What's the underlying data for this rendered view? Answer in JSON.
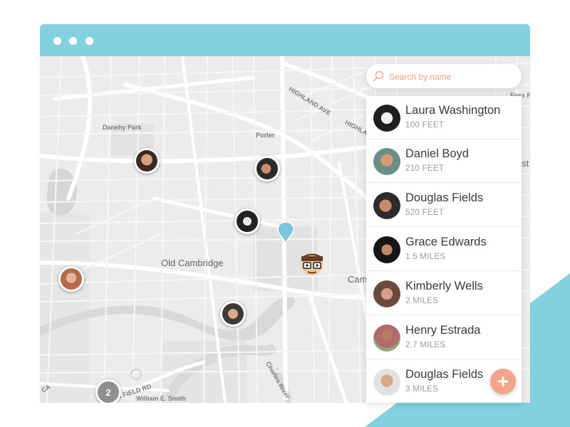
{
  "window": {
    "titlebar_color": "#84cfe0",
    "controls": [
      "dot",
      "dot",
      "dot"
    ]
  },
  "map": {
    "labels": {
      "highland_ave": "HIGHLAND AVE",
      "highland_ave_2": "HIGHLAND AVE",
      "danehy_park": "Danehy Park",
      "porter": "Porter",
      "old_cambridge": "Old Cambridge",
      "cam": "Cam",
      "st": "st",
      "foss_p": "Foss P",
      "charles_river": "Charles River",
      "field_rd": "ERS FIELD RD",
      "william_smith": "William E. Smith",
      "ca": "CA"
    },
    "cluster_count": "2",
    "pin_color": "#78c7dc"
  },
  "search": {
    "placeholder": "Search by name",
    "icon": "search-icon",
    "accent": "#f2a07e"
  },
  "people": [
    {
      "name": "Laura Washington",
      "distance": "100 FEET"
    },
    {
      "name": "Daniel Boyd",
      "distance": "210 FEET"
    },
    {
      "name": "Douglas Fields",
      "distance": "520 FEET"
    },
    {
      "name": "Grace Edwards",
      "distance": "1.5 MILES"
    },
    {
      "name": "Kimberly Wells",
      "distance": "2 MILES"
    },
    {
      "name": "Henry Estrada",
      "distance": "2.7 MILES"
    },
    {
      "name": "Douglas Fields",
      "distance": "3 MILES"
    }
  ],
  "fab": {
    "icon": "plus-icon",
    "color": "#f4a48a"
  },
  "decor": {
    "triangle_color": "#84cfe0"
  }
}
